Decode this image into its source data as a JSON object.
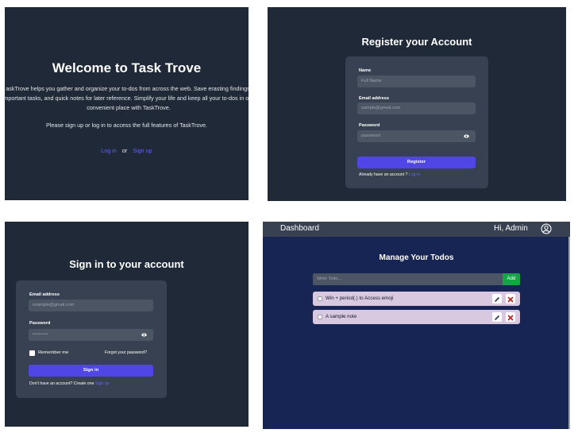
{
  "welcome": {
    "title": "Welcome to Task Trove",
    "description": "askTrove helps you gather and organize your to-dos from across the web. Save erasting findings, important tasks, and quick notes for later reference. Simplify your life and keep all your to-dos in one convenient place with TaskTrove.",
    "prompt": "Please sign up or log in to access the full features of TaskTrove.",
    "login_link": "Log in",
    "or_text": "or",
    "signup_link": "Sign up"
  },
  "register": {
    "title": "Register your Account",
    "name_label": "Name",
    "name_placeholder": "Full Name",
    "email_label": "Email address",
    "email_placeholder": "sample@gmail.com",
    "password_label": "Password",
    "password_placeholder": "password",
    "submit_label": "Register",
    "footer_text": "Already have an account ?",
    "footer_link": "Log in"
  },
  "signin": {
    "title": "Sign in to your account",
    "email_label": "Email address",
    "email_placeholder": "example@gmail.com",
    "password_label": "Password",
    "password_value": "••••••••",
    "remember_label": "Remember me",
    "forgot_link": "Forgot your password?",
    "submit_label": "Sign in",
    "footer_text": "Don't have an account? Create one",
    "footer_link": "Sign up"
  },
  "dashboard": {
    "brand": "Dashboard",
    "greeting": "Hi, Admin",
    "user_icon": "user-circle-icon",
    "title": "Manage Your Todos",
    "input_placeholder": "Write Todo...",
    "add_label": "Add",
    "todos": [
      {
        "text": "Win + period(.) to Access emoji",
        "checked": false
      },
      {
        "text": "A sample note",
        "checked": false
      }
    ]
  },
  "colors": {
    "panel_bg": "#1f2937",
    "card_bg": "#374151",
    "input_bg": "#4b5563",
    "primary": "#4f46e5",
    "link": "#6366f1",
    "dashboard_bg": "#172554",
    "add_button": "#16a34a",
    "todo_bg": "#d8c8e0",
    "delete_icon": "#b91c1c",
    "edit_icon": "#374151"
  }
}
